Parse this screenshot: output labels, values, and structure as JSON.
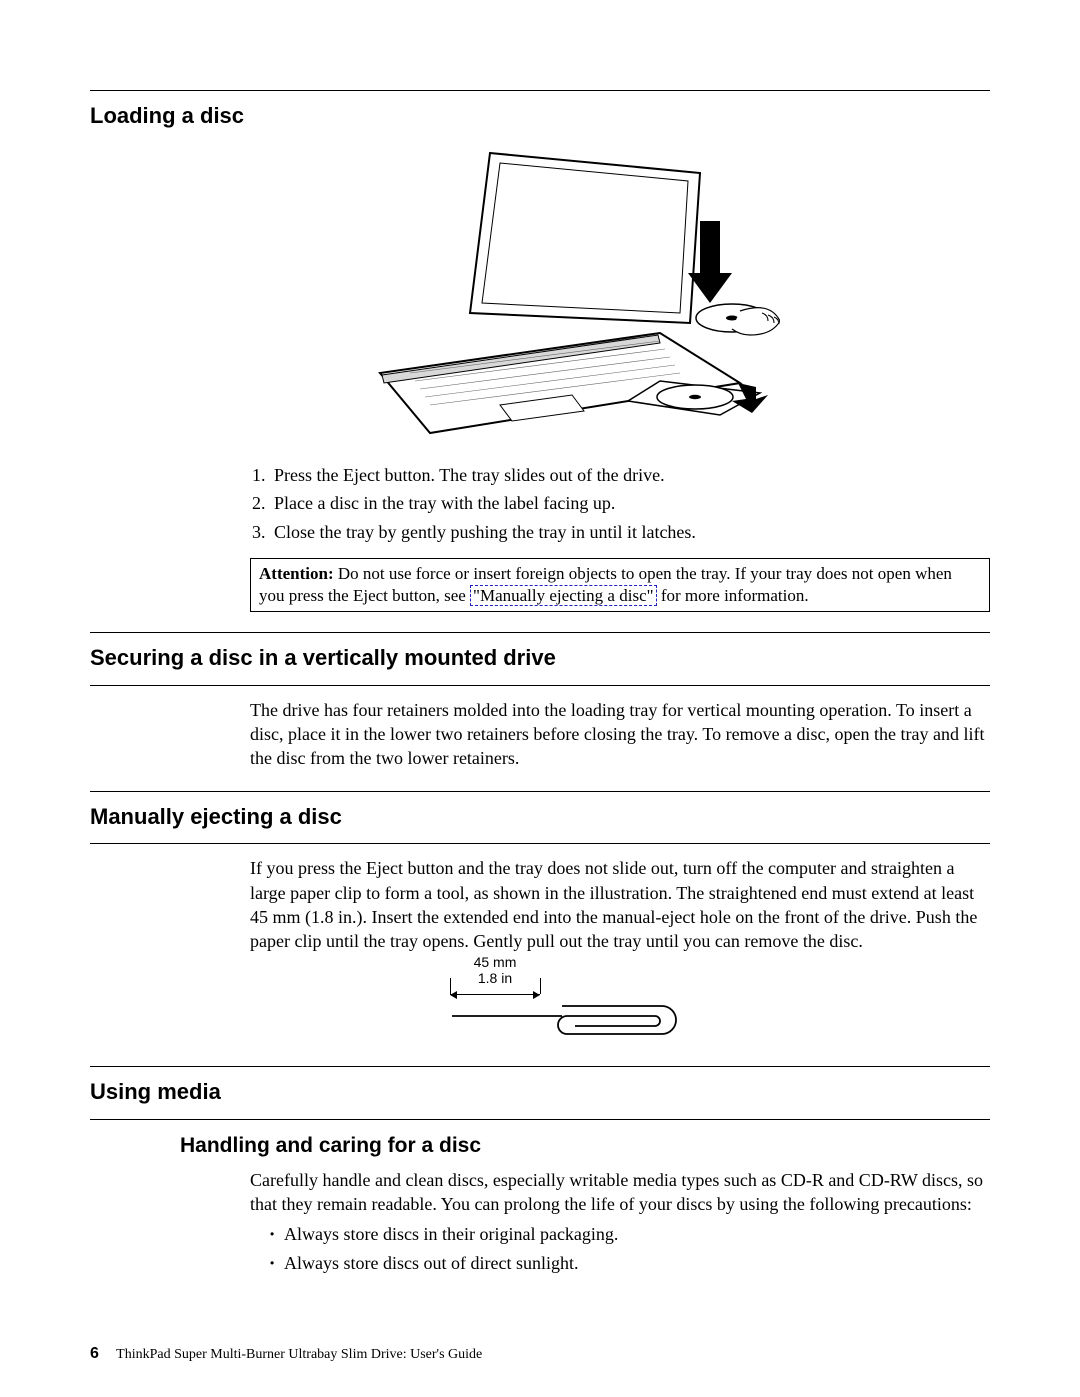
{
  "sections": {
    "loading": {
      "heading": "Loading a disc",
      "steps": [
        "Press the Eject button. The tray slides out of the drive.",
        "Place a disc in the tray with the label facing up.",
        "Close the tray by gently pushing the tray in until it latches."
      ],
      "attention_label": "Attention:",
      "attention_before": " Do not use force or insert foreign objects to open the tray. If your tray does not open when you press the Eject button, see ",
      "attention_link": "\"Manually ejecting a disc\"",
      "attention_after": " for more information."
    },
    "securing": {
      "heading": "Securing a disc in a vertically mounted drive",
      "body": "The drive has four retainers molded into the loading tray for vertical mounting operation. To insert a disc, place it in the lower two retainers before closing the tray. To remove a disc, open the tray and lift the disc from the two lower retainers."
    },
    "manual_eject": {
      "heading": "Manually ejecting a disc",
      "body": "If you press the Eject button and the tray does not slide out, turn off the computer and straighten a large paper clip to form a tool, as shown in the illustration. The straightened end must extend at least 45 mm (1.8 in.). Insert the extended end into the manual-eject hole on the front of the drive. Push the paper clip until the tray opens. Gently pull out the tray until you can remove the disc.",
      "clip_mm": "45 mm",
      "clip_in": "1.8 in"
    },
    "using_media": {
      "heading": "Using media",
      "sub_heading": "Handling and caring for a disc",
      "body": "Carefully handle and clean discs, especially writable media types such as CD-R and CD-RW discs, so that they remain readable. You can prolong the life of your discs by using the following precautions:",
      "bullets": [
        "Always store discs in their original packaging.",
        "Always store discs out of direct sunlight."
      ]
    }
  },
  "footer": {
    "page_number": "6",
    "doc_title": "ThinkPad Super Multi-Burner Ultrabay Slim Drive: User's Guide"
  }
}
